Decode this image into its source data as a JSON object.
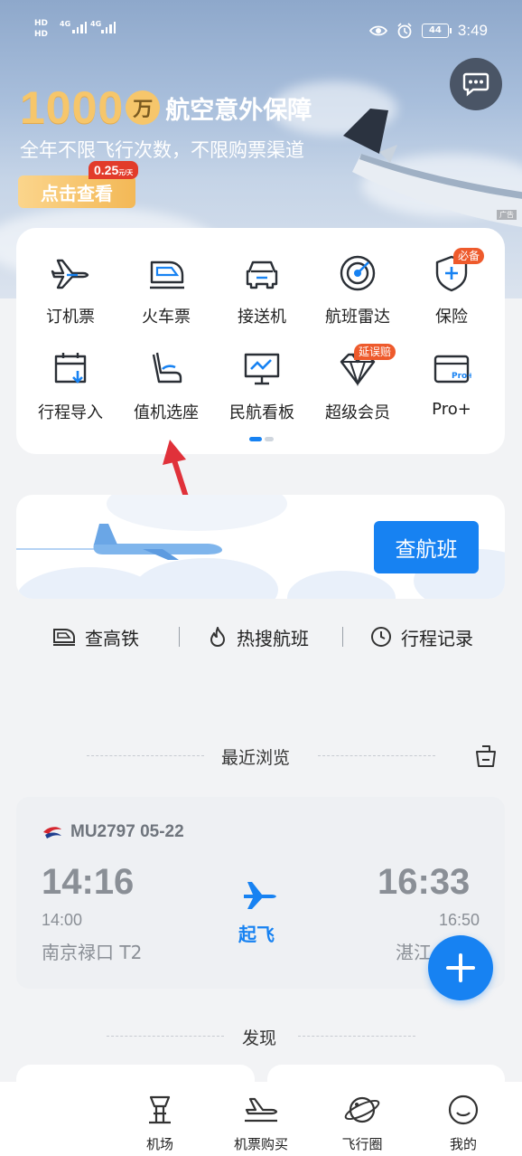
{
  "status_bar": {
    "hd1": "HD",
    "hd2": "HD",
    "net1": "4G",
    "net2": "4G",
    "battery": "44",
    "time": "3:49"
  },
  "promo": {
    "amount": "1000",
    "unit": "万",
    "title": "航空意外保障",
    "subtitle": "全年不限飞行次数，不限购票渠道",
    "button": "点击查看",
    "price": "0.25",
    "price_unit": "元/天",
    "ad_label": "广告"
  },
  "services": {
    "row1": [
      {
        "label": "订机票",
        "icon": "plane-icon"
      },
      {
        "label": "火车票",
        "icon": "train-icon"
      },
      {
        "label": "接送机",
        "icon": "car-icon"
      },
      {
        "label": "航班雷达",
        "icon": "radar-icon"
      },
      {
        "label": "保险",
        "icon": "shield-plus-icon",
        "badge": "必备"
      }
    ],
    "row2": [
      {
        "label": "行程导入",
        "icon": "calendar-import-icon"
      },
      {
        "label": "值机选座",
        "icon": "seat-icon"
      },
      {
        "label": "民航看板",
        "icon": "monitor-chart-icon"
      },
      {
        "label": "超级会员",
        "icon": "diamond-icon",
        "badge": "延误赔"
      },
      {
        "label": "Pro+",
        "icon": "card-pro-icon"
      }
    ]
  },
  "search": {
    "button": "查航班"
  },
  "quick_links": [
    {
      "label": "查高铁",
      "icon": "high-speed-rail-icon"
    },
    {
      "label": "热搜航班",
      "icon": "flame-icon"
    },
    {
      "label": "行程记录",
      "icon": "clock-icon"
    }
  ],
  "recent": {
    "section_title": "最近浏览",
    "flight": "MU2797 05-22",
    "dep_time": "14:16",
    "dep_scheduled": "14:00",
    "dep_city": "南京禄口 T2",
    "status": "起飞",
    "arr_time": "16:33",
    "arr_scheduled": "16:50",
    "arr_city": "湛江"
  },
  "discover": {
    "section_title": "发现"
  },
  "bottom_nav": [
    {
      "label": "机场",
      "icon": "airport-tower-icon"
    },
    {
      "label": "机票购买",
      "icon": "ticket-plane-icon"
    },
    {
      "label": "飞行圈",
      "icon": "planet-icon"
    },
    {
      "label": "我的",
      "icon": "smiley-icon"
    }
  ],
  "colors": {
    "accent": "#1782f2",
    "promo_gold": "#f6c66b",
    "badge_orange": "#ee5a2c",
    "page_bg": "#f2f3f5"
  }
}
